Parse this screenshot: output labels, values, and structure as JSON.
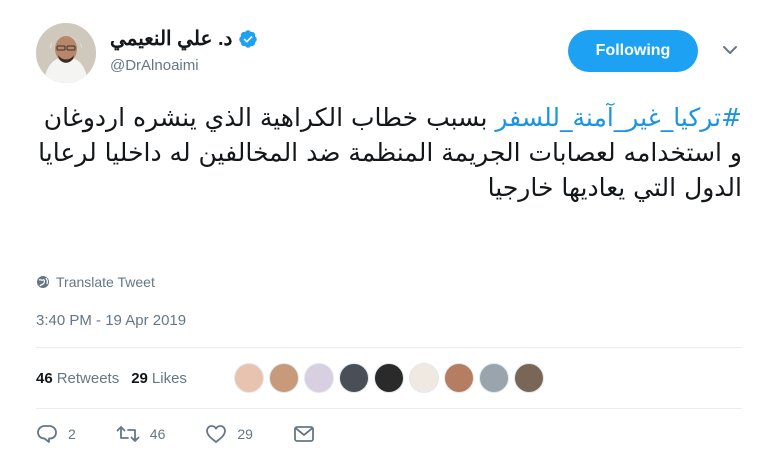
{
  "author": {
    "display_name": "د. علي النعيمي",
    "handle": "@DrAlnoaimi"
  },
  "follow_button_label": "Following",
  "tweet": {
    "hashtag": "#تركيا_غير_آمنة_للسفر",
    "body": " بسبب خطاب الكراهية الذي ينشره اردوغان و استخدامه لعصابات الجريمة المنظمة ضد المخالفين له داخليا لرعايا الدول التي يعاديها خارجيا"
  },
  "translate_label": "Translate Tweet",
  "timestamp": "3:40 PM - 19 Apr 2019",
  "stats": {
    "retweets_count": "46",
    "retweets_label": "Retweets",
    "likes_count": "29",
    "likes_label": "Likes"
  },
  "likers": [
    "#e8c4b0",
    "#c79a7a",
    "#d8cfe0",
    "#4a4f57",
    "#2a2a2a",
    "#efe9e1",
    "#b57d62",
    "#9aa4ad",
    "#7a6656"
  ],
  "actions": {
    "reply_count": "2",
    "retweet_count": "46",
    "like_count": "29"
  },
  "colors": {
    "accent": "#1da1f2",
    "link": "#1b95e0",
    "muted": "#657786"
  },
  "icons": [
    "verified-badge-icon",
    "chevron-down-icon",
    "globe-icon",
    "reply-icon",
    "retweet-icon",
    "heart-icon",
    "mail-icon"
  ]
}
